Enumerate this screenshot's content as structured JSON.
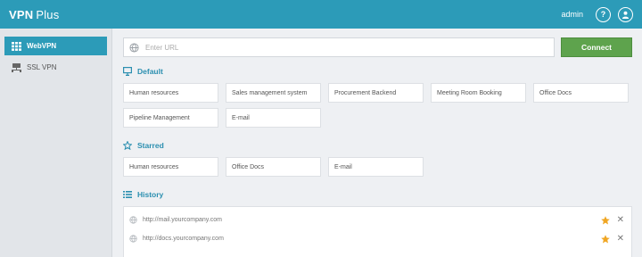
{
  "app": {
    "title_bold": "VPN",
    "title_light": "Plus"
  },
  "header": {
    "user": "admin",
    "help_glyph": "?"
  },
  "sidebar": {
    "items": [
      {
        "label": "WebVPN",
        "icon": "grid-icon",
        "active": true
      },
      {
        "label": "SSL VPN",
        "icon": "network-icon",
        "active": false
      }
    ]
  },
  "url_bar": {
    "placeholder": "Enter URL",
    "value": "",
    "connect_label": "Connect"
  },
  "sections": {
    "default": {
      "title": "Default",
      "tiles": [
        "Human resources",
        "Sales management system",
        "Procurement Backend",
        "Meeting Room Booking",
        "Office Docs",
        "Pipeline Management",
        "E-mail"
      ]
    },
    "starred": {
      "title": "Starred",
      "tiles": [
        "Human resources",
        "Office Docs",
        "E-mail"
      ]
    },
    "history": {
      "title": "History",
      "items": [
        {
          "url": "http://mail.yourcompany.com",
          "starred": true,
          "close_glyph": "✕"
        },
        {
          "url": "http://docs.yourcompany.com",
          "starred": true,
          "close_glyph": "✕"
        }
      ]
    }
  },
  "colors": {
    "accent": "#2c9bb8",
    "connect": "#5ea34d",
    "star": "#f0a623"
  }
}
